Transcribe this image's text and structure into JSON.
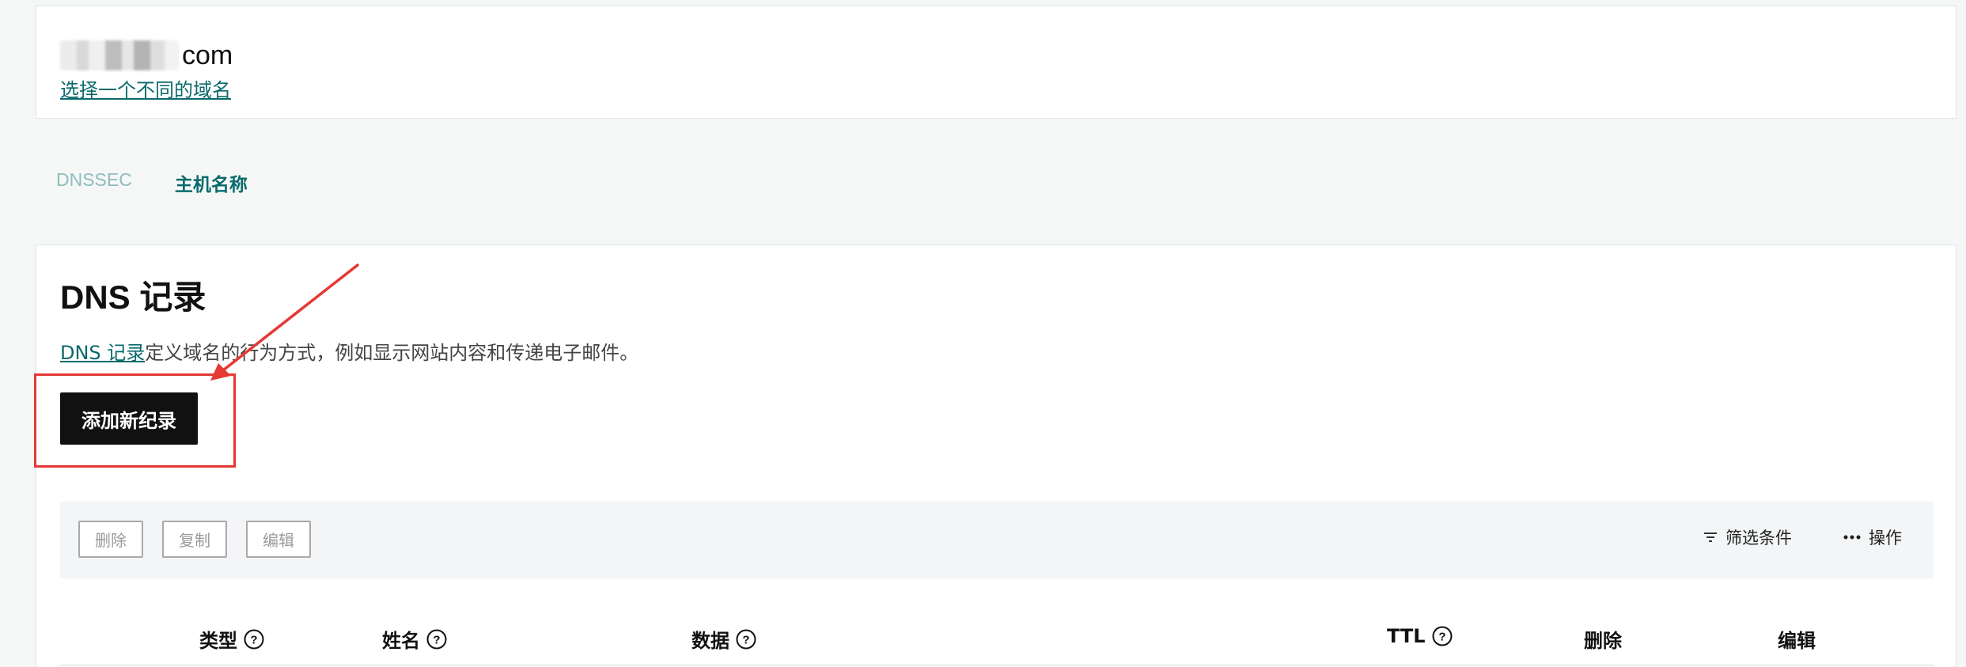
{
  "domain": {
    "suffix": "com",
    "switch_link": "选择一个不同的域名"
  },
  "tabs": [
    {
      "label": "DNSSEC"
    },
    {
      "label": "主机名称"
    }
  ],
  "dns": {
    "title": "DNS 记录",
    "desc_link": "DNS 记录",
    "desc_text": "定义域名的行为方式，例如显示网站内容和传递电子邮件。",
    "add_button": "添加新纪录"
  },
  "toolbar": {
    "delete": "删除",
    "copy": "复制",
    "edit": "编辑",
    "filter": "筛选条件",
    "actions": "操作"
  },
  "table": {
    "columns": [
      "类型",
      "姓名",
      "数据",
      "TTL",
      "删除",
      "编辑"
    ]
  },
  "colors": {
    "accent": "#0a6a6b",
    "annotation": "#e53935",
    "button_dark": "#111111"
  }
}
